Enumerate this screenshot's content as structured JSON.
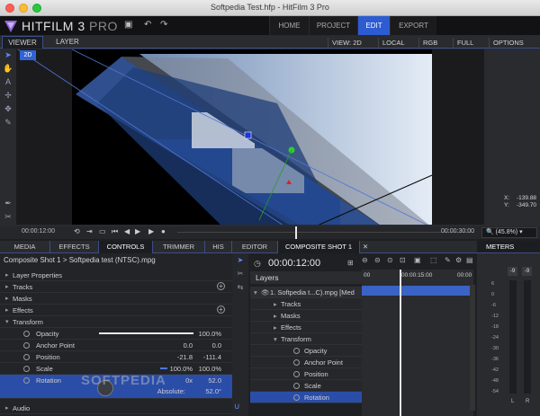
{
  "window": {
    "title": "Softpedia Test.hfp - HitFilm 3 Pro"
  },
  "app": {
    "name_main": "HITFILM 3",
    "name_pro": " PRO"
  },
  "nav": {
    "home": "HOME",
    "project": "PROJECT",
    "edit": "EDIT",
    "export": "EXPORT"
  },
  "viewer_tabs": {
    "viewer": "VIEWER",
    "layer": "LAYER"
  },
  "viewer_options": {
    "view": "VIEW: 2D",
    "space": "LOCAL",
    "color": "RGB",
    "quality": "FULL",
    "options": "OPTIONS"
  },
  "viewer": {
    "badge": "2D",
    "coord_x_label": "X:",
    "coord_x": "-139.88",
    "coord_y_label": "Y:",
    "coord_y": "-349.70"
  },
  "transport": {
    "time_current": "00:00:12:00",
    "time_end": "00:00:30:00",
    "zoom": "(45.8%)"
  },
  "left_tabs": {
    "media": "MEDIA",
    "effects": "EFFECTS",
    "controls": "CONTROLS",
    "trimmer": "TRIMMER",
    "more": "HIS"
  },
  "controls": {
    "path": "Composite Shot 1 > Softpedia test (NTSC).mpg",
    "layer_properties": "Layer Properties",
    "tracks": "Tracks",
    "masks": "Masks",
    "effects": "Effects",
    "transform": "Transform",
    "opacity_label": "Opacity",
    "opacity_value": "100.0%",
    "anchor_label": "Anchor Point",
    "anchor_x": "0.0",
    "anchor_y": "0.0",
    "position_label": "Position",
    "position_x": "-21.8",
    "position_y": "-111.4",
    "scale_label": "Scale",
    "scale_x": "100.0%",
    "scale_y": "100.0%",
    "rotation_label": "Rotation",
    "rotation_turns": "0x",
    "rotation_value": "52.0",
    "absolute_label": "Absolute:",
    "absolute_value": "52.0°",
    "audio": "Audio"
  },
  "watermark": "SOFTPEDIA",
  "editor_tabs": {
    "editor": "EDITOR",
    "composite": "COMPOSITE SHOT 1",
    "close": "✕"
  },
  "editor": {
    "timecode": "00:00:12:00",
    "layers_header": "Layers",
    "layer_name": "1. Softpedia t...C).mpg [Med",
    "rows": {
      "tracks": "Tracks",
      "masks": "Masks",
      "effects": "Effects",
      "transform": "Transform",
      "opacity": "Opacity",
      "anchor": "Anchor Point",
      "position": "Position",
      "scale": "Scale",
      "rotation": "Rotation"
    },
    "ruler_start": "00",
    "ruler_mid": "00:00:15:00",
    "ruler_end": "00:00"
  },
  "meters": {
    "title": "METERS",
    "left_peak": "-9",
    "right_peak": "-9",
    "left": "L",
    "right": "R",
    "scale": [
      "6",
      "0",
      "-6",
      "-12",
      "-18",
      "-24",
      "-30",
      "-36",
      "-42",
      "-48",
      "-54"
    ]
  }
}
